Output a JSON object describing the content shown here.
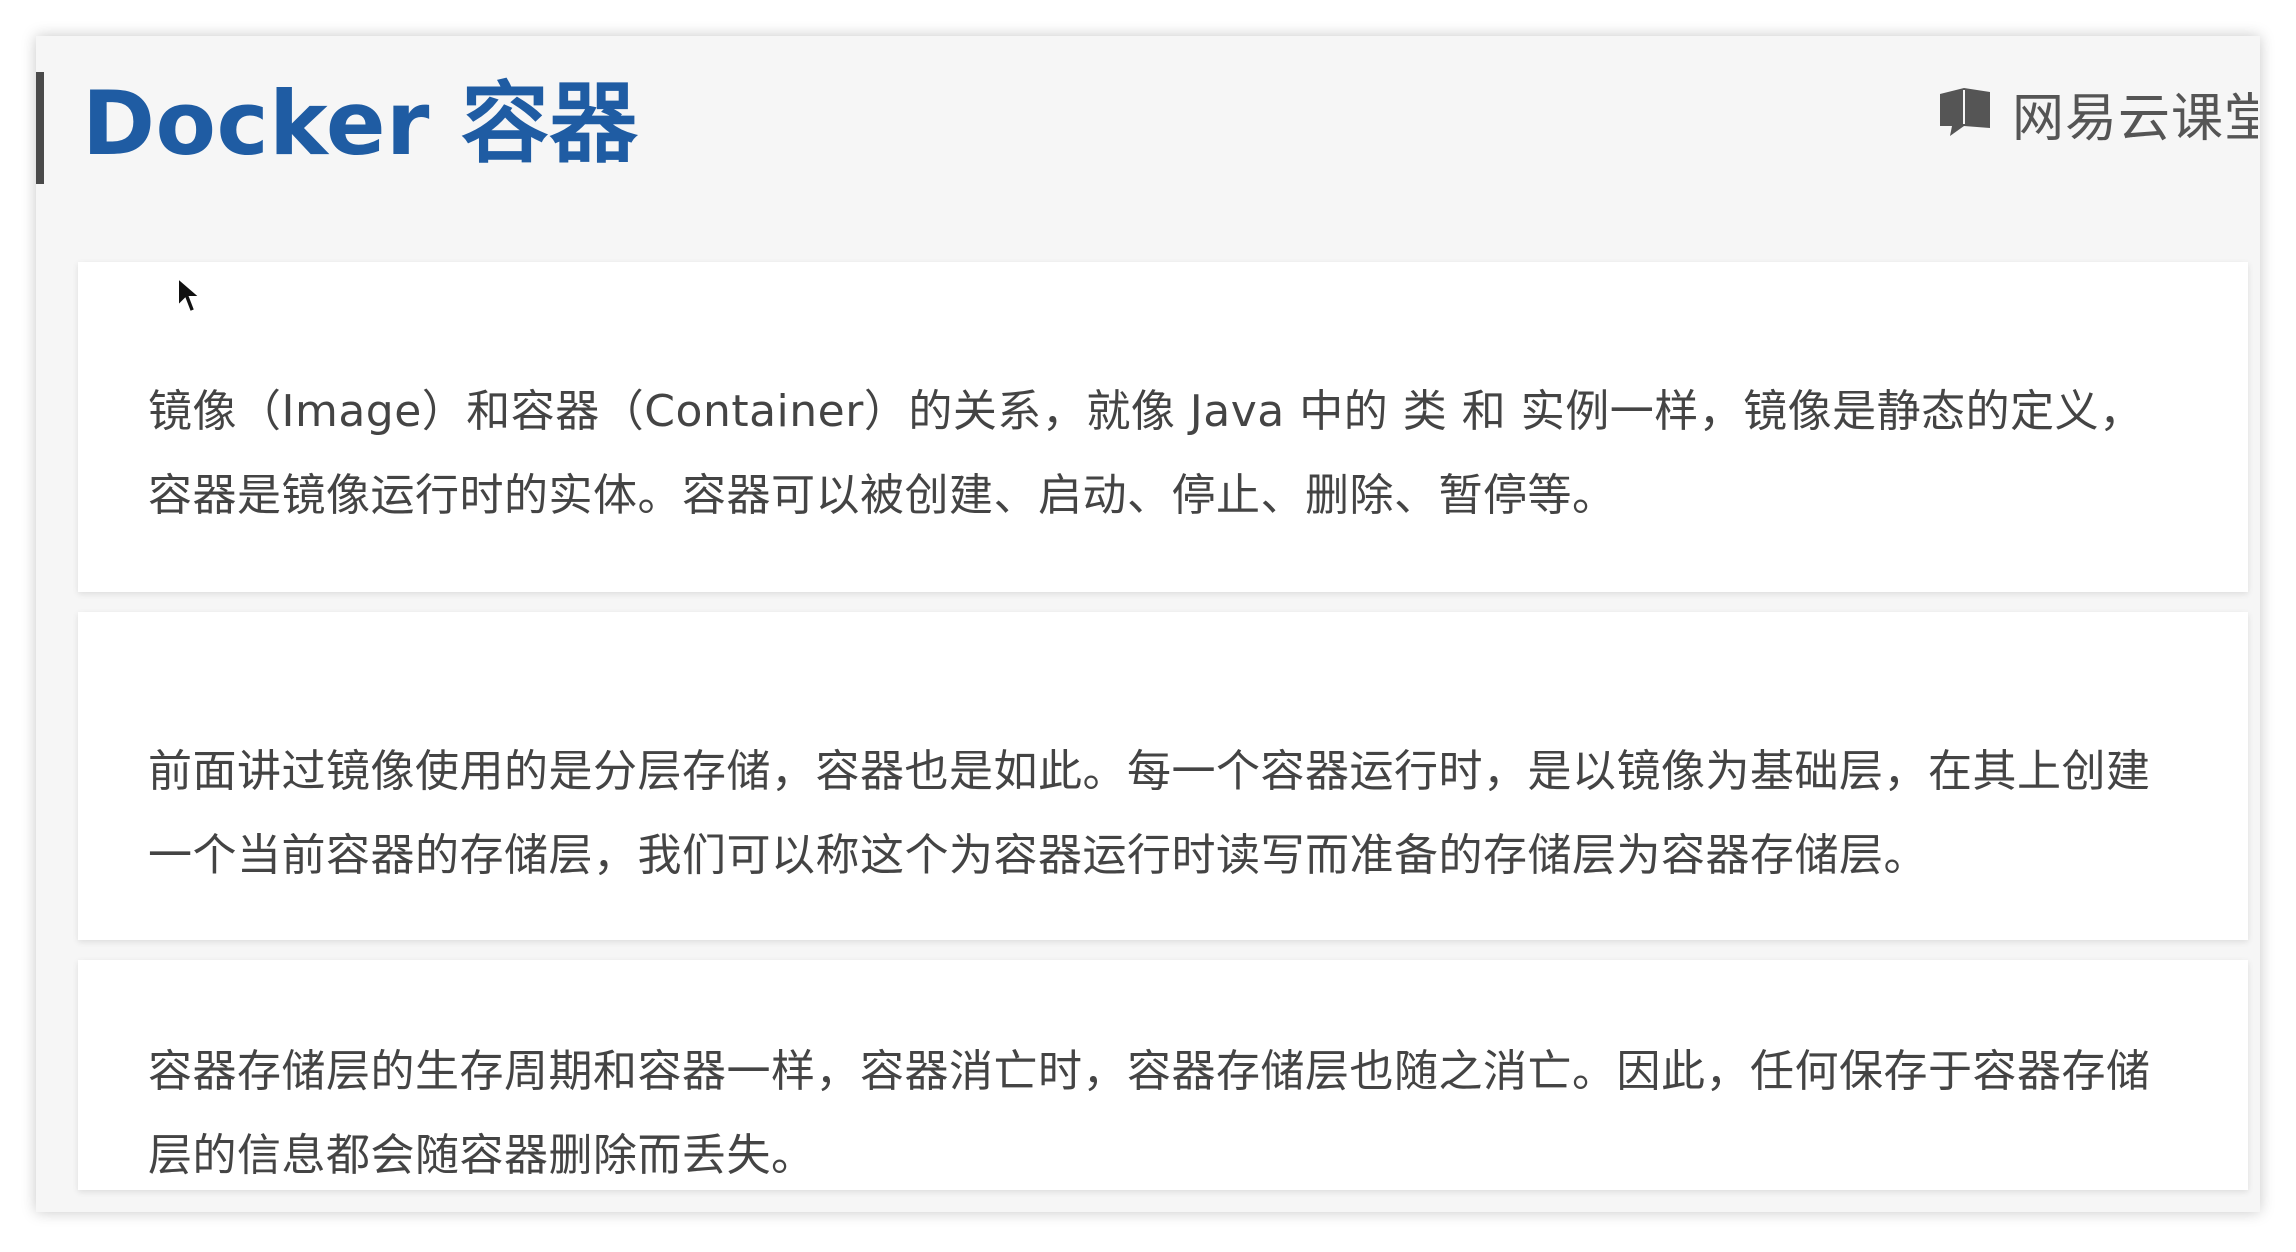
{
  "slide": {
    "title": "Docker 容器",
    "brand": {
      "icon": "chat-book-icon",
      "text": "网易云课堂"
    },
    "paragraphs": [
      "镜像（Image）和容器（Container）的关系，就像 Java 中的 类 和 实例一样，镜像是静态的定义，容器是镜像运行时的实体。容器可以被创建、启动、停止、删除、暂停等。",
      "前面讲过镜像使用的是分层存储，容器也是如此。每一个容器运行时，是以镜像为基础层，在其上创建一个当前容器的存储层，我们可以称这个为容器运行时读写而准备的存储层为容器存储层。",
      "容器存储层的生存周期和容器一样，容器消亡时，容器存储层也随之消亡。因此，任何保存于容器存储层的信息都会随容器删除而丢失。"
    ]
  },
  "colors": {
    "title": "#1f5ca3",
    "text": "#444444",
    "brand": "#555555",
    "accent_bar": "#4a4a4a"
  }
}
